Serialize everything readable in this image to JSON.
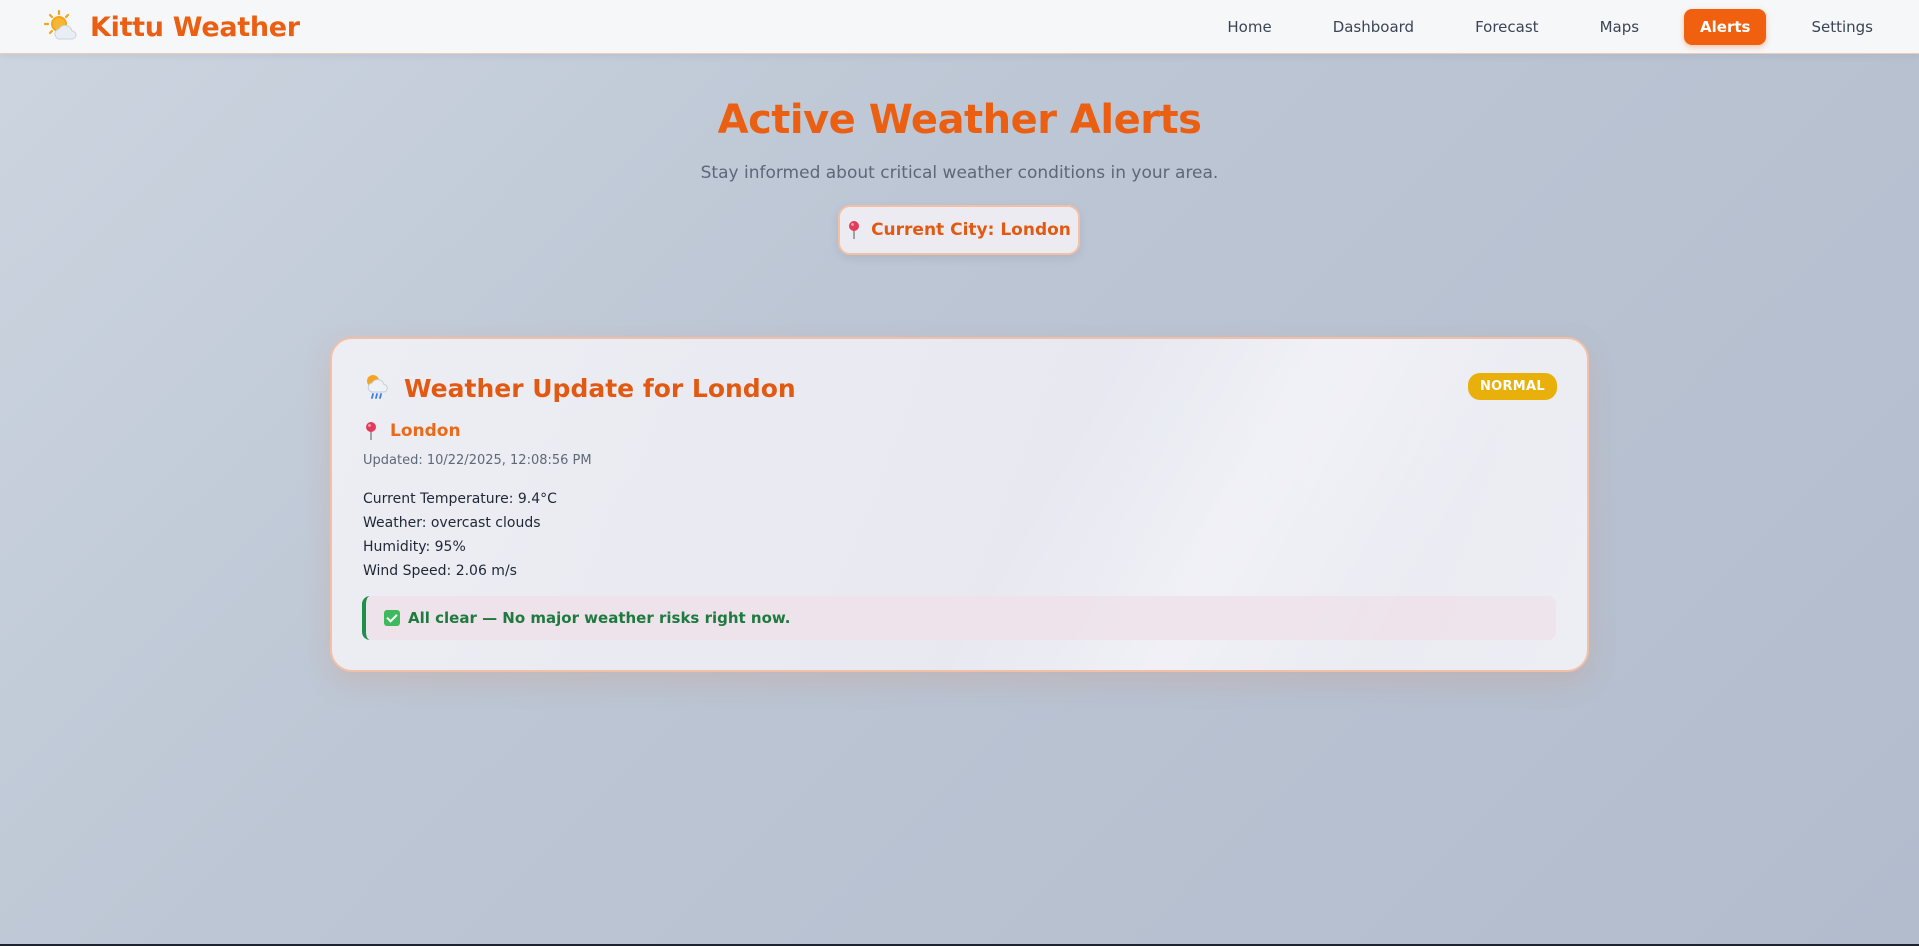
{
  "app": {
    "title": "Kittu Weather",
    "logo_icon": "sun-behind-cloud-icon"
  },
  "nav": {
    "items": [
      {
        "label": "Home",
        "active": false
      },
      {
        "label": "Dashboard",
        "active": false
      },
      {
        "label": "Forecast",
        "active": false
      },
      {
        "label": "Maps",
        "active": false
      },
      {
        "label": "Alerts",
        "active": true
      },
      {
        "label": "Settings",
        "active": false
      }
    ]
  },
  "header": {
    "title": "Active Weather Alerts",
    "subtitle": "Stay informed about critical weather conditions in your area.",
    "current_city_label": "Current City: London"
  },
  "card": {
    "title": "Weather Update for London",
    "badge": "NORMAL",
    "city": "London",
    "updated": "Updated: 10/22/2025, 12:08:56 PM",
    "details": [
      "Current Temperature: 9.4°C",
      "Weather: overcast clouds",
      "Humidity: 95%",
      "Wind Speed: 2.06 m/s"
    ],
    "status_message": "All clear — No major weather risks right now."
  },
  "colors": {
    "accent": "#ea5f12",
    "badge": "#e9b00c",
    "success": "#1e7a3f"
  }
}
